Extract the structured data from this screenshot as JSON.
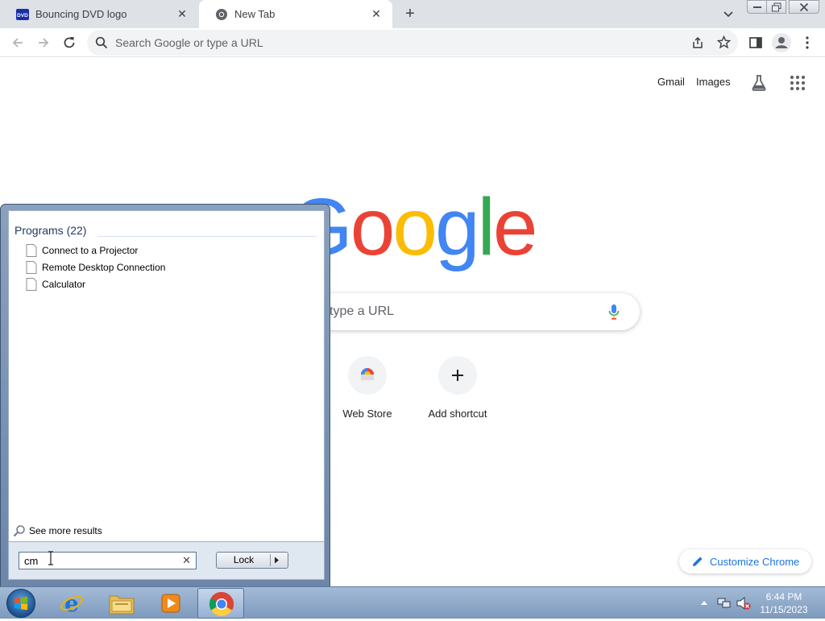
{
  "browser": {
    "tabs": [
      {
        "label": "Bouncing DVD logo",
        "icon": "dvd-icon"
      },
      {
        "label": "New Tab",
        "icon": "chrome-icon"
      }
    ],
    "address_placeholder": "Search Google or type a URL"
  },
  "ntp": {
    "header_links": [
      "Gmail",
      "Images"
    ],
    "search_placeholder": "type a URL",
    "shortcuts": [
      {
        "label": "Web Store",
        "icon": "web-store-icon"
      },
      {
        "label": "Add shortcut",
        "icon": "plus-icon"
      }
    ],
    "customize_label": "Customize Chrome"
  },
  "start_menu": {
    "heading": "Programs (22)",
    "items": [
      "Connect to a Projector",
      "Remote Desktop Connection",
      "Calculator"
    ],
    "see_more": "See more results",
    "search_value": "cm",
    "lock_label": "Lock"
  },
  "taskbar": {
    "pinned": [
      "internet-explorer-icon",
      "windows-explorer-icon",
      "media-player-icon",
      "chrome-icon"
    ],
    "time": "6:44 PM",
    "date": "11/15/2023"
  },
  "colors": {
    "google_blue": "#4285f4",
    "google_red": "#ea4335",
    "google_yellow": "#fbbc05",
    "google_green": "#34a853",
    "link_blue": "#1a73e8"
  }
}
